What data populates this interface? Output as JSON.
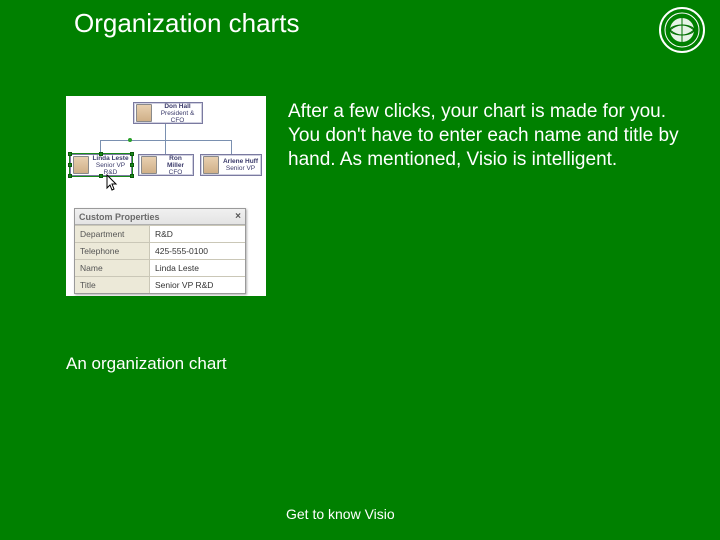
{
  "title": "Organization charts",
  "body_text": "After a few clicks, your chart is made for you. You don't have to enter each name and title by hand. As mentioned, Visio is intelligent.",
  "caption": "An organization chart",
  "footer": "Get to know Visio",
  "org": {
    "top": {
      "name": "Don Hall",
      "title": "President & CFO"
    },
    "left": {
      "name": "Linda Leste",
      "title": "Senior VP R&D"
    },
    "mid": {
      "name": "Ron Miller",
      "title": "CFO"
    },
    "right": {
      "name": "Arlene Huff",
      "title": "Senior VP"
    }
  },
  "properties": {
    "window_title": "Custom Properties",
    "rows": [
      {
        "label": "Department",
        "value": "R&D"
      },
      {
        "label": "Telephone",
        "value": "425-555-0100"
      },
      {
        "label": "Name",
        "value": "Linda Leste"
      },
      {
        "label": "Title",
        "value": "Senior VP R&D"
      }
    ]
  }
}
